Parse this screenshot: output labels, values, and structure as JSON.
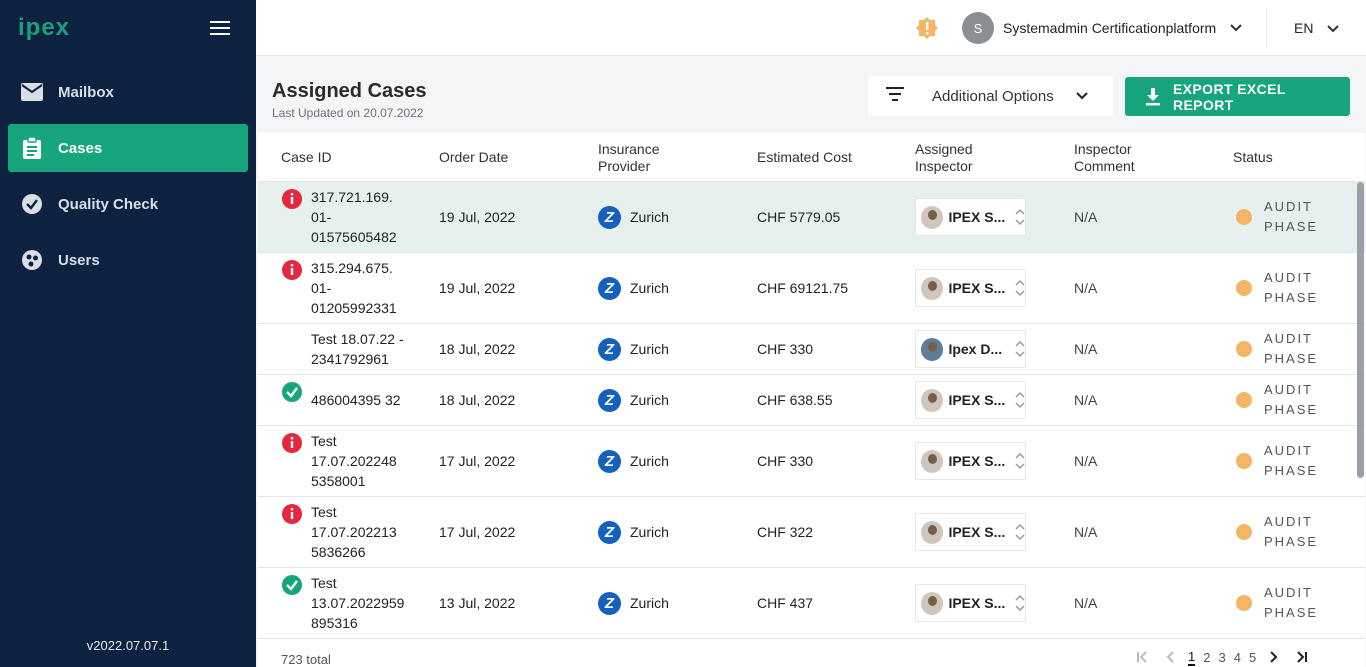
{
  "sidebar": {
    "logo": "ipex",
    "items": [
      {
        "label": "Mailbox",
        "icon": "mail-icon"
      },
      {
        "label": "Cases",
        "icon": "clipboard-icon"
      },
      {
        "label": "Quality Check",
        "icon": "check-circle-icon"
      },
      {
        "label": "Users",
        "icon": "users-icon"
      }
    ],
    "version": "v2022.07.07.1"
  },
  "topbar": {
    "user_initial": "S",
    "user_name": "Systemadmin Certificationplatform",
    "language": "EN"
  },
  "page": {
    "title": "Assigned Cases",
    "subtitle": "Last Updated on 20.07.2022",
    "options_label": "Additional Options",
    "export_label": "EXPORT EXCEL REPORT"
  },
  "table": {
    "headers": {
      "case_id": "Case ID",
      "order_date": "Order Date",
      "provider_1": "Insurance",
      "provider_2": "Provider",
      "cost": "Estimated Cost",
      "inspector_1": "Assigned",
      "inspector_2": "Inspector",
      "comment_1": "Inspector",
      "comment_2": "Comment",
      "status": "Status"
    },
    "rows": [
      {
        "case_id": [
          "317.721.169.",
          "01-",
          "01575605482"
        ],
        "flag": "alert",
        "order_date": "19 Jul, 2022",
        "provider": "Zurich",
        "cost": "CHF 5779.05",
        "inspector": "IPEX S...",
        "comment": "N/A",
        "status": [
          "AUDIT",
          "PHASE"
        ]
      },
      {
        "case_id": [
          "315.294.675.",
          "01-",
          "01205992331"
        ],
        "flag": "alert",
        "order_date": "19 Jul, 2022",
        "provider": "Zurich",
        "cost": "CHF 69121.75",
        "inspector": "IPEX S...",
        "comment": "N/A",
        "status": [
          "AUDIT",
          "PHASE"
        ]
      },
      {
        "case_id": [
          "Test 18.07.22 -",
          "2341792961"
        ],
        "flag": "none",
        "order_date": "18 Jul, 2022",
        "provider": "Zurich",
        "cost": "CHF 330",
        "inspector": "Ipex D...",
        "comment": "N/A",
        "status": [
          "AUDIT",
          "PHASE"
        ]
      },
      {
        "case_id": [
          "486004395 32"
        ],
        "flag": "ok",
        "order_date": "18 Jul, 2022",
        "provider": "Zurich",
        "cost": "CHF 638.55",
        "inspector": "IPEX S...",
        "comment": "N/A",
        "status": [
          "AUDIT",
          "PHASE"
        ]
      },
      {
        "case_id": [
          "Test",
          "17.07.202248",
          "5358001"
        ],
        "flag": "alert",
        "order_date": "17 Jul, 2022",
        "provider": "Zurich",
        "cost": "CHF 330",
        "inspector": "IPEX S...",
        "comment": "N/A",
        "status": [
          "AUDIT",
          "PHASE"
        ]
      },
      {
        "case_id": [
          "Test",
          "17.07.202213",
          "5836266"
        ],
        "flag": "alert",
        "order_date": "17 Jul, 2022",
        "provider": "Zurich",
        "cost": "CHF 322",
        "inspector": "IPEX S...",
        "comment": "N/A",
        "status": [
          "AUDIT",
          "PHASE"
        ]
      },
      {
        "case_id": [
          "Test",
          "13.07.2022959",
          "895316"
        ],
        "flag": "ok",
        "order_date": "13 Jul, 2022",
        "provider": "Zurich",
        "cost": "CHF 437",
        "inspector": "IPEX S...",
        "comment": "N/A",
        "status": [
          "AUDIT",
          "PHASE"
        ]
      }
    ],
    "total": "723 total"
  },
  "pagination": {
    "pages": [
      "1",
      "2",
      "3",
      "4",
      "5"
    ],
    "current": "1"
  },
  "colors": {
    "sidebar_bg": "#0d2240",
    "accent": "#17a57d",
    "alert": "#e5273f",
    "ok": "#17a57d",
    "status_dot": "#f2b665",
    "zurich_blue": "#1560bd"
  }
}
